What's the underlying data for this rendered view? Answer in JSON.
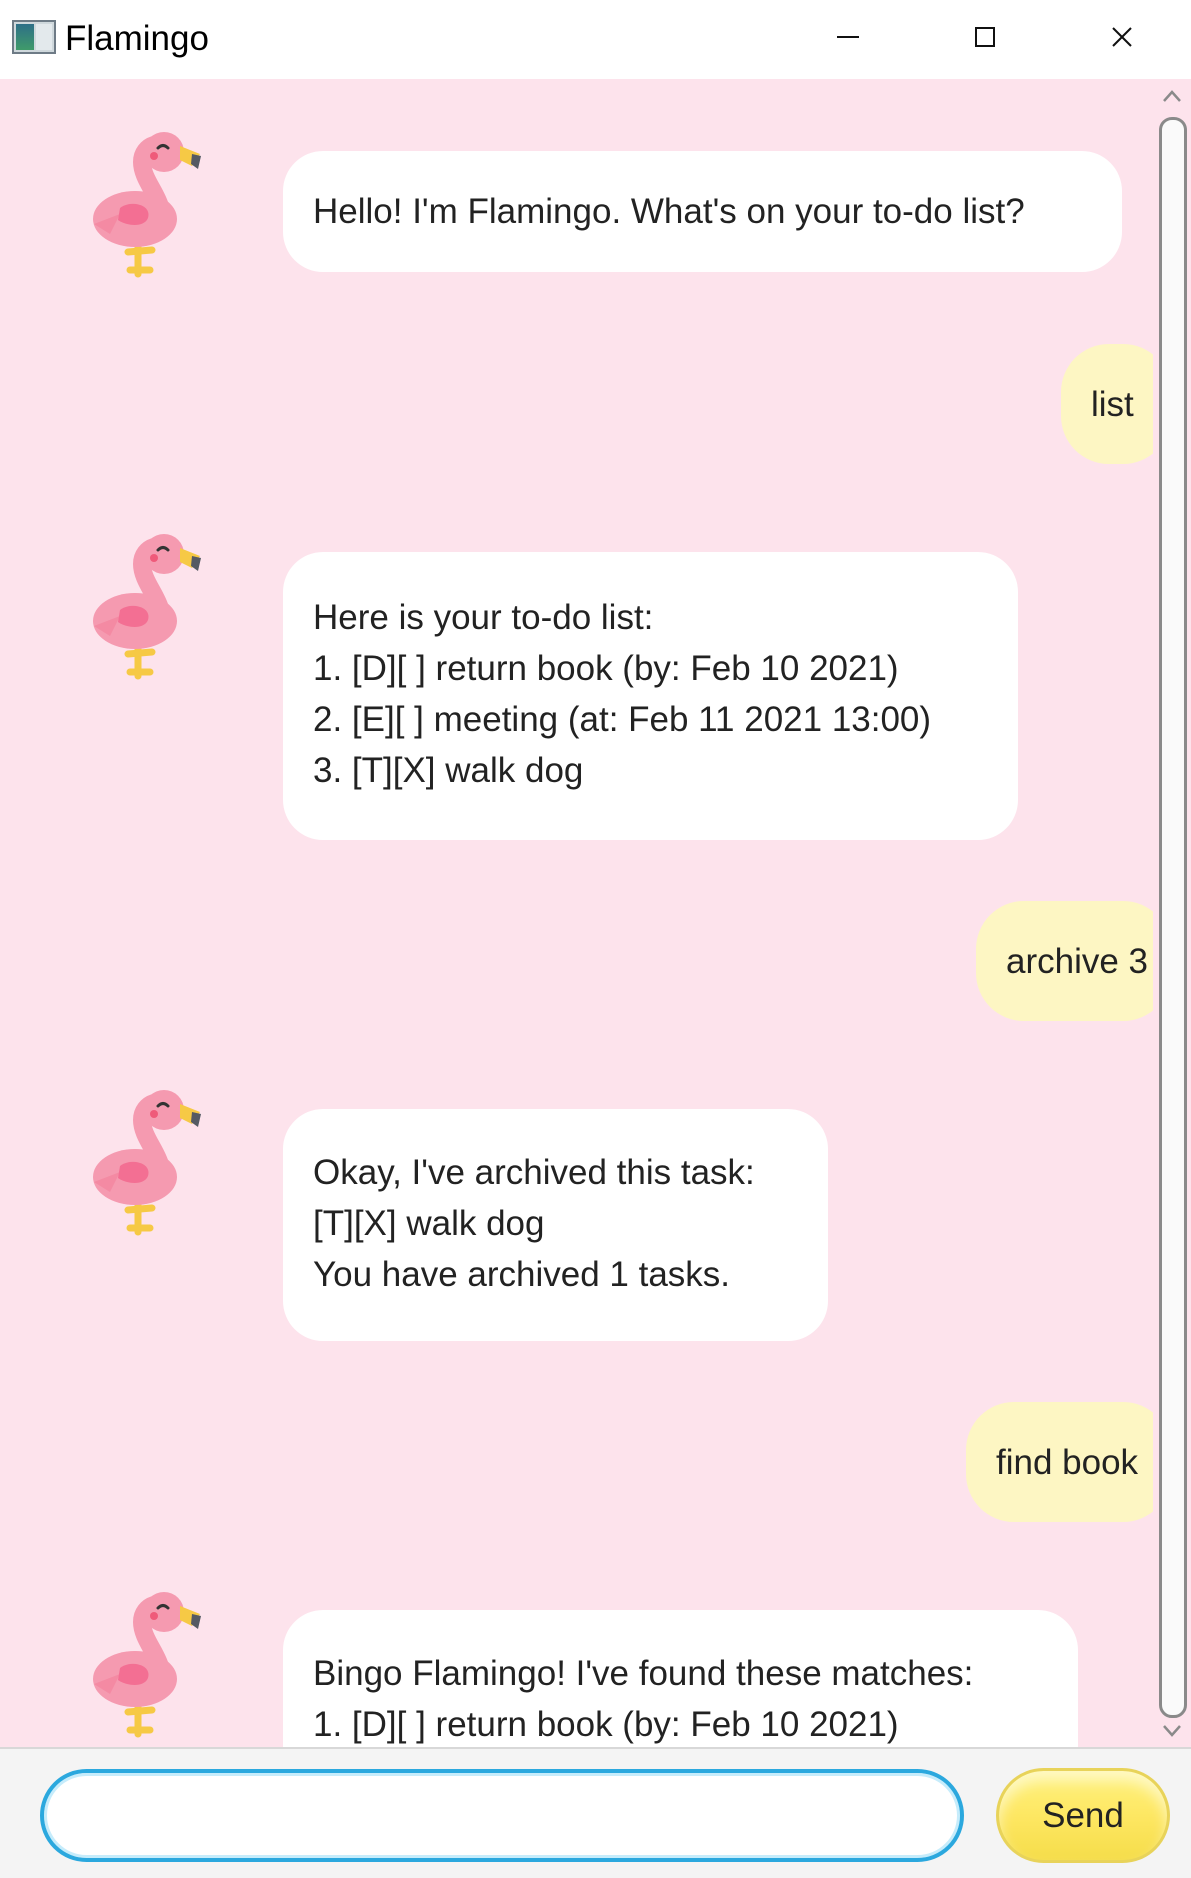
{
  "window": {
    "title": "Flamingo"
  },
  "chat": {
    "messages": [
      {
        "from": "bot",
        "lines": [
          "Hello! I'm Flamingo. What's on your to-do list?"
        ]
      },
      {
        "from": "user",
        "text": "list"
      },
      {
        "from": "bot",
        "lines": [
          "Here is your to-do list:",
          "1. [D][ ] return book (by: Feb 10 2021)",
          "2. [E][ ] meeting (at: Feb 11 2021 13:00)",
          "3. [T][X] walk dog"
        ]
      },
      {
        "from": "user",
        "text": "archive 3"
      },
      {
        "from": "bot",
        "lines": [
          "Okay, I've archived this task:",
          "[T][X] walk dog",
          "You have archived 1 tasks."
        ]
      },
      {
        "from": "user",
        "text": "find book"
      },
      {
        "from": "bot",
        "lines": [
          "Bingo Flamingo! I've found these matches:",
          "1. [D][ ] return book (by: Feb 10 2021)"
        ]
      }
    ]
  },
  "input": {
    "value": "",
    "placeholder": ""
  },
  "send": {
    "label": "Send"
  },
  "colors": {
    "chat_background": "#fde3ec",
    "bot_bubble": "#ffffff",
    "user_bubble": "#fdf6c3",
    "send_button": "#fde660",
    "input_border": "#2ba8de"
  },
  "icons": {
    "avatar": "flamingo-icon",
    "minimize": "minimize-icon",
    "maximize": "maximize-icon",
    "close": "close-icon"
  }
}
